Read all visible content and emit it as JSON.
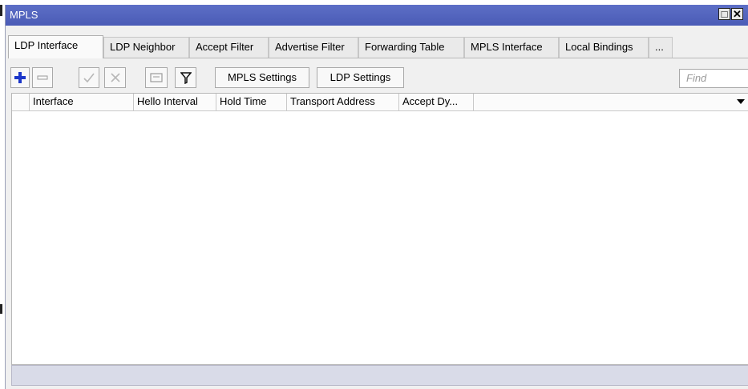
{
  "window": {
    "title": "MPLS",
    "restore_glyph": "□",
    "close_glyph": "✕"
  },
  "tabs": [
    {
      "label": "LDP Interface",
      "active": true
    },
    {
      "label": "LDP Neighbor",
      "active": false
    },
    {
      "label": "Accept Filter",
      "active": false
    },
    {
      "label": "Advertise Filter",
      "active": false
    },
    {
      "label": "Forwarding Table",
      "active": false
    },
    {
      "label": "MPLS Interface",
      "active": false
    },
    {
      "label": "Local Bindings",
      "active": false
    },
    {
      "label": "...",
      "active": false
    }
  ],
  "toolbar": {
    "add_icon": "plus-icon",
    "remove_icon": "minus-icon",
    "enable_icon": "check-icon",
    "disable_icon": "x-icon",
    "comment_icon": "comment-icon",
    "filter_icon": "filter-icon",
    "mpls_settings_label": "MPLS Settings",
    "ldp_settings_label": "LDP Settings",
    "find_placeholder": "Find"
  },
  "table": {
    "columns": [
      {
        "label": "Interface",
        "sorted": true
      },
      {
        "label": "Hello Interval"
      },
      {
        "label": "Hold Time"
      },
      {
        "label": "Transport Address"
      },
      {
        "label": "Accept Dy..."
      }
    ],
    "sort_indicator": "/",
    "rows": []
  },
  "colors": {
    "titlebar": "#4f60bb",
    "statusbar": "#d9dbe8",
    "add_icon": "#1b36c9"
  }
}
